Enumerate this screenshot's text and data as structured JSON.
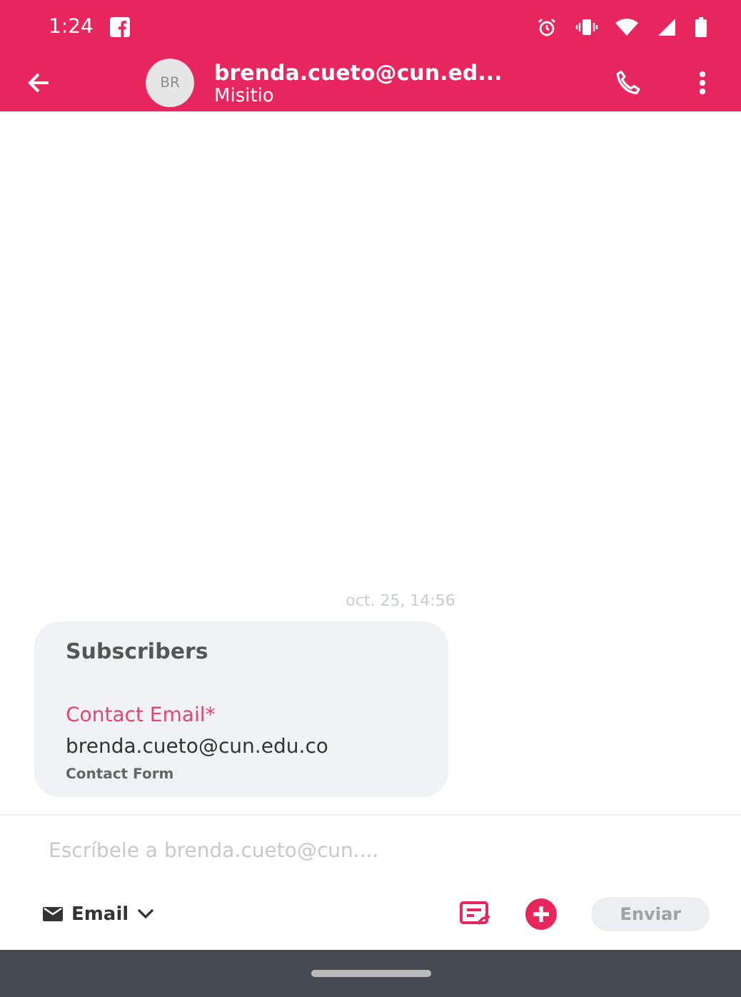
{
  "status_bar": {
    "time": "1:24"
  },
  "header": {
    "avatar_initials": "BR",
    "title": "brenda.cueto@cun.ed...",
    "subtitle": "Misitio"
  },
  "messages": [
    {
      "timestamp": "oct. 25, 14:56",
      "heading": "Subscribers",
      "field_label": "Contact Email*",
      "field_value": "brenda.cueto@cun.edu.co",
      "source": "Contact Form"
    }
  ],
  "composer": {
    "placeholder": "Escríbele a brenda.cueto@cun....",
    "channel": "Email",
    "send": {
      "label": "Enviar",
      "disabled": true
    }
  }
}
